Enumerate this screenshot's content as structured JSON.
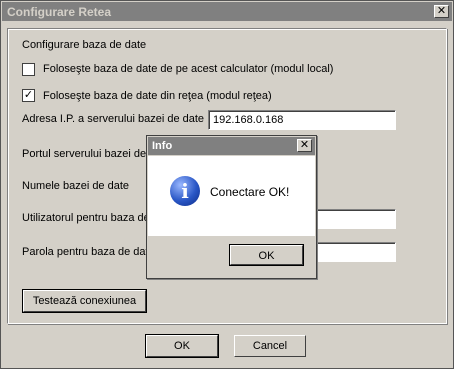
{
  "window": {
    "title": "Configurare Retea",
    "close_glyph": "✕"
  },
  "group": {
    "title": "Configurare baza de date"
  },
  "options": {
    "local": {
      "label": "Foloseşte baza de date de pe acest calculator (modul local)",
      "checked": false
    },
    "network": {
      "label": "Foloseşte baza de date din reţea (modul reţea)",
      "checked": true,
      "check_glyph": "✓"
    }
  },
  "fields": {
    "server_ip": {
      "label": "Adresa I.P. a serverului bazei de date",
      "value": "192.168.0.168"
    },
    "server_port": {
      "label": "Portul serverului bazei de d",
      "value": ""
    },
    "db_name": {
      "label": "Numele bazei de date",
      "value": ""
    },
    "db_user": {
      "label": "Utilizatorul pentru baza de",
      "value": ""
    },
    "db_password": {
      "label": "Parola pentru baza de date",
      "value": ""
    }
  },
  "buttons": {
    "test": "Testează conexiunea",
    "ok": "OK",
    "cancel": "Cancel"
  },
  "info_dialog": {
    "title": "Info",
    "close_glyph": "✕",
    "icon": "information-icon",
    "icon_glyph": "i",
    "message": "Conectare OK!",
    "ok": "OK"
  }
}
